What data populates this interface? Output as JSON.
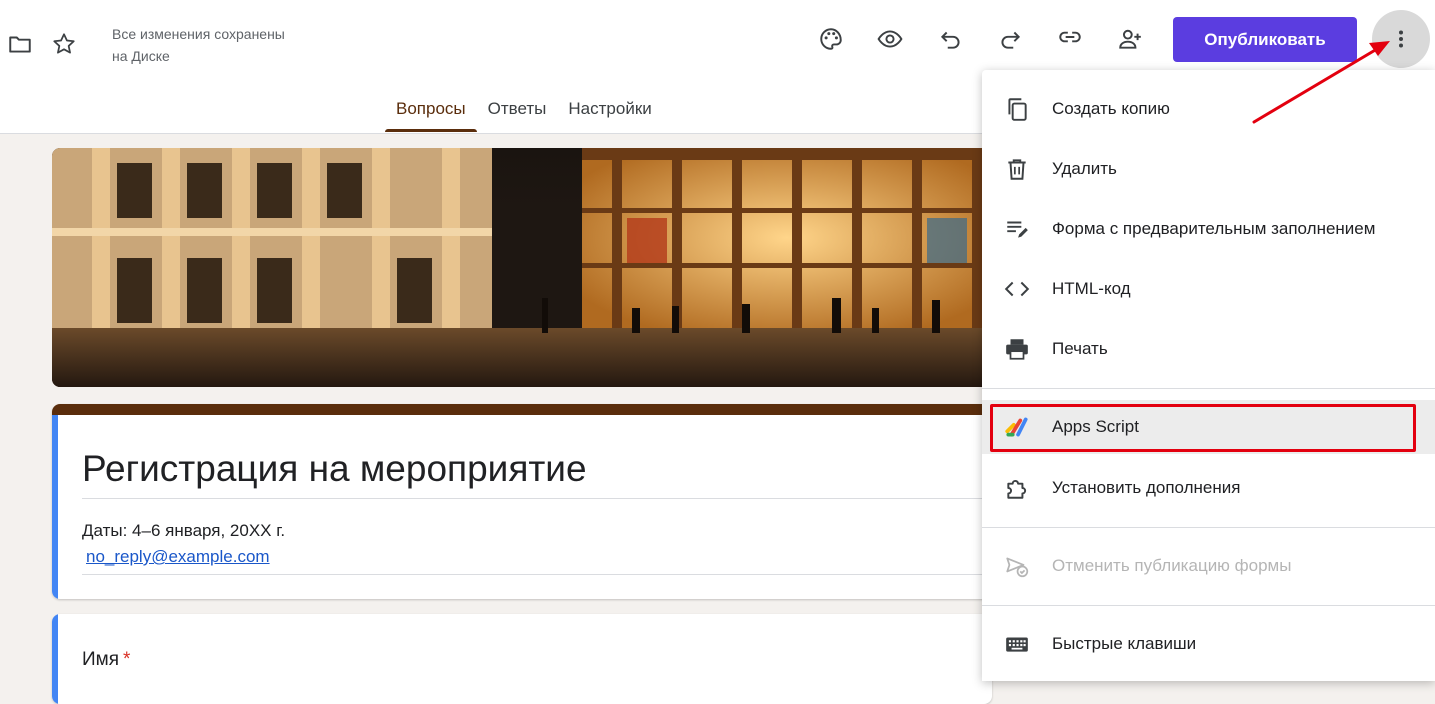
{
  "header": {
    "saved_status_line1": "Все изменения сохранены",
    "saved_status_line2": "на Диске",
    "publish_label": "Опубликовать",
    "icons": [
      "folder-icon",
      "star-icon",
      "palette-icon",
      "eye-icon",
      "undo-icon",
      "redo-icon",
      "link-icon",
      "add-person-icon",
      "more-vert-icon"
    ]
  },
  "tabs": [
    {
      "label": "Вопросы",
      "active": true
    },
    {
      "label": "Ответы",
      "active": false
    },
    {
      "label": "Настройки",
      "active": false
    }
  ],
  "form": {
    "title": "Регистрация на мероприятие",
    "description": "Даты: 4–6 января, 20XX г.",
    "email": "no_reply@example.com",
    "question_label": "Имя",
    "required_mark": "*"
  },
  "menu": {
    "items": [
      {
        "label": "Создать копию",
        "icon": "copy-icon"
      },
      {
        "label": "Удалить",
        "icon": "trash-icon"
      },
      {
        "label": "Форма с предварительным заполнением",
        "icon": "prefill-icon"
      },
      {
        "label": "HTML-код",
        "icon": "code-icon"
      },
      {
        "label": "Печать",
        "icon": "print-icon"
      },
      {
        "label": "Apps Script",
        "icon": "apps-script-icon",
        "highlighted": true
      },
      {
        "label": "Установить дополнения",
        "icon": "puzzle-icon"
      },
      {
        "label": "Отменить публикацию формы",
        "icon": "unpublish-icon",
        "disabled": true
      },
      {
        "label": "Быстрые клавиши",
        "icon": "keyboard-icon"
      }
    ]
  },
  "colors": {
    "accent": "#5b3de0",
    "theme": "#5a2d0c",
    "annotation": "#e3000f"
  }
}
